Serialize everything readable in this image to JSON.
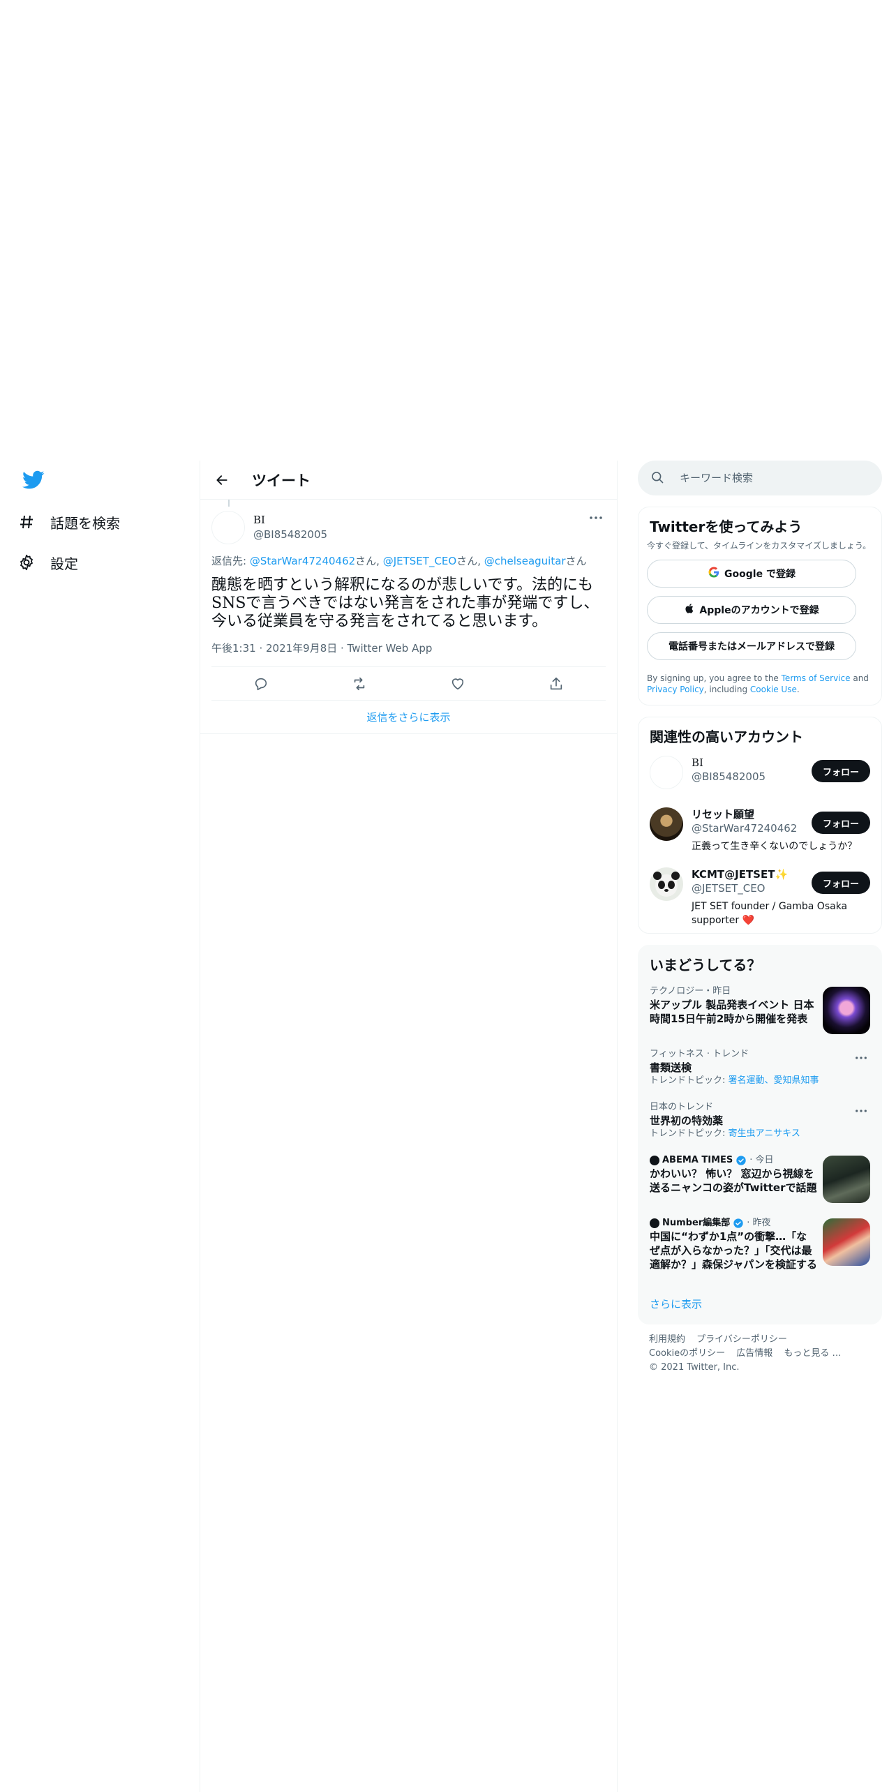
{
  "nav": {
    "items": [
      {
        "label": "話題を検索",
        "icon": "hashtag-icon"
      },
      {
        "label": "設定",
        "icon": "gear-icon"
      }
    ]
  },
  "header": {
    "title": "ツイート"
  },
  "tweet": {
    "author_name": "BI",
    "author_handle": "@BI85482005",
    "reply_prefix": "返信先: ",
    "reply_to": [
      {
        "handle": "@StarWar47240462",
        "suffix": "さん, "
      },
      {
        "handle": "@JETSET_CEO",
        "suffix": "さん, "
      },
      {
        "handle": "@chelseaguitar",
        "suffix": "さん"
      }
    ],
    "text": "醜態を晒すという解釈になるのが悲しいです。法的にもSNSで言うべきではない発言をされた事が発端ですし、今いる従業員を守る発言をされてると思います。",
    "meta": "午後1:31 · 2021年9月8日 · Twitter Web App"
  },
  "show_more_replies": "返信をさらに表示",
  "search": {
    "placeholder": "キーワード検索"
  },
  "signup": {
    "title": "Twitterを使ってみよう",
    "subtitle": "今すぐ登録して、タイムラインをカスタマイズしましょう。",
    "google": "Google で登録",
    "apple": "Appleのアカウントで登録",
    "phone": "電話番号またはメールアドレスで登録",
    "legal_1": "By signing up, you agree to the ",
    "terms": "Terms of Service",
    "legal_2": " and ",
    "privacy": "Privacy Policy",
    "legal_3": ", including ",
    "cookie": "Cookie Use",
    "legal_4": "."
  },
  "related": {
    "title": "関連性の高いアカウント",
    "follow_label": "フォロー",
    "accounts": [
      {
        "name": "BI",
        "handle": "@BI85482005",
        "bio": ""
      },
      {
        "name": "リセット願望",
        "handle": "@StarWar47240462",
        "bio": "正義って生き辛くないのでしょうか？"
      },
      {
        "name": "KCMT@JETSET✨",
        "handle": "@JETSET_CEO",
        "bio": "JET SET founder / Gamba Osaka supporter ❤️"
      }
    ]
  },
  "trends": {
    "title": "いまどうしてる？",
    "items": [
      {
        "context": "テクノロジー・昨日",
        "title": "米アップル 製品発表イベント 日本時間15日午前2時から開催を発表"
      },
      {
        "context": "フィットネス · トレンド",
        "title": "書類送検",
        "topics_prefix": "トレンドトピック: ",
        "topics": "署名運動、愛知県知事"
      },
      {
        "context": "日本のトレンド",
        "title": "世界初の特効薬",
        "topics_prefix": "トレンドトピック: ",
        "topics": "寄生虫アニサキス"
      },
      {
        "source": "ABEMA TIMES",
        "time": " · 今日",
        "title": "かわいい？ 怖い？ 窓辺から視線を送るニャンコの姿がTwitterで話題"
      },
      {
        "source": "Number編集部",
        "time": " · 昨夜",
        "title": "中国に“わずか1点”の衝撃…「なぜ点が入らなかった？」「交代は最適解か？」森保ジャパンを検証する"
      }
    ],
    "show_more": "さらに表示"
  },
  "footer": {
    "links_1": [
      "利用規約",
      "プライバシーポリシー"
    ],
    "links_2": [
      "Cookieのポリシー",
      "広告情報",
      "もっと見る …"
    ],
    "copyright": "© 2021 Twitter, Inc."
  },
  "colors": {
    "accent": "#1d9bf0",
    "text": "#0f1419",
    "muted": "#536471",
    "border": "#eff3f4"
  }
}
